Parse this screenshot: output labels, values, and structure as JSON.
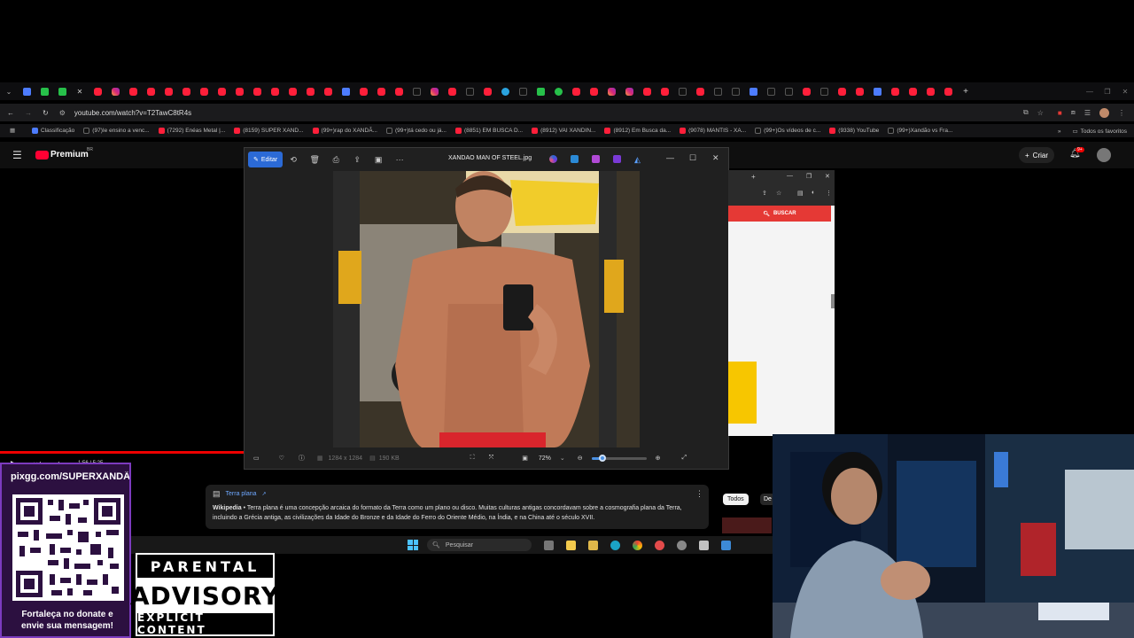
{
  "browser": {
    "url": "youtube.com/watch?v=T2TawC8tR4s",
    "all_bookmarks": "Todos os favoritos",
    "bookmarks": [
      "Classificação",
      "(97)Ie ensino a venc...",
      "(7292) Enéas Metal |...",
      "(8159) SUPER XAND...",
      "(99+)rap do XANDÃ...",
      "(99+)tá cedo ou já...",
      "(8851) EM BUSCA D...",
      "(8912) VAI XANDIN...",
      "(8912) Em Busca da...",
      "(9078) MANTIS - XA...",
      "(99+)Os vídeos de c...",
      "(9338) YouTube",
      "(99+)Xandão vs Fra..."
    ]
  },
  "youtube": {
    "logo": "Premium",
    "region": "BR",
    "create_label": "Criar",
    "notif_badge": "9+",
    "video_time": "1:56 / 5:25",
    "chip_all": "Todos",
    "chip_de": "De"
  },
  "viewer": {
    "edit_label": "Editar",
    "title": "XANDAO MAN OF STEEL.jpg",
    "dimensions": "1284 x 1284",
    "size": "190 KB",
    "zoom": "72%",
    "zoom_level": 0.2
  },
  "second_window": {
    "search_button": "BUSCAR"
  },
  "wiki": {
    "heading": "Terra plana",
    "source": "Wikipedia",
    "text": " • Terra plana é uma concepção arcaica do formato da Terra como um plano ou disco. Muitas culturas antigas concordavam sobre a cosmografia plana da Terra, incluindo a Grécia antiga, as civilizações da Idade do Bronze e da Idade do Ferro do Oriente Médio, na Índia, e na China até o século XVII."
  },
  "taskbar": {
    "search_placeholder": "Pesquisar"
  },
  "overlay": {
    "pix": "pixgg.com/SUPERXANDÃO",
    "donate_line1": "Fortaleça no donate e",
    "donate_line2": "envie sua mensagem!",
    "parental_top": "PARENTAL",
    "parental_mid": "ADVISORY",
    "parental_bot": "EXPLICIT CONTENT"
  },
  "colors": {
    "accent_blue": "#2b6ad6",
    "yt_red": "#ff0033",
    "overlay_purple": "#2c1040"
  }
}
